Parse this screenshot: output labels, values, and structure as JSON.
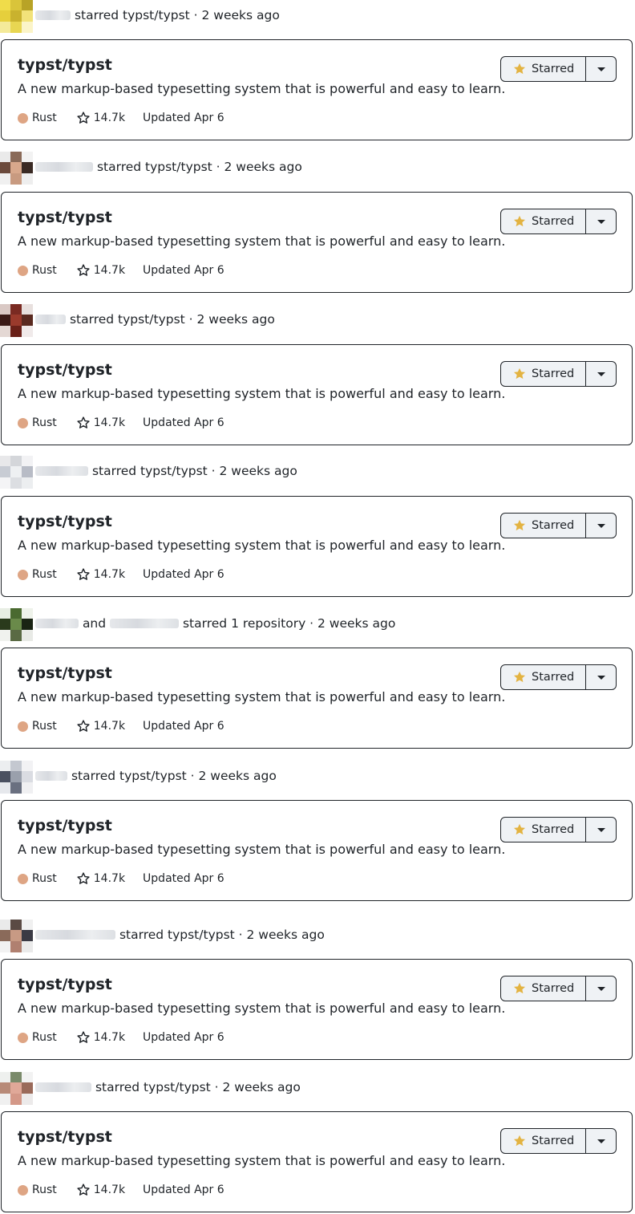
{
  "feed": [
    {
      "text": "starred typst/typst · 2 weeks ago",
      "name_width": 44,
      "avatar": "yellow",
      "repo": {
        "name": "typst/typst",
        "description": "A new markup-based typesetting system that is powerful and easy to learn.",
        "language": "Rust",
        "stars": "14.7k",
        "updated": "Updated Apr 6",
        "button": "Starred"
      }
    },
    {
      "text": "starred typst/typst · 2 weeks ago",
      "name_width": 72,
      "avatar": "face-tan",
      "repo": {
        "name": "typst/typst",
        "description": "A new markup-based typesetting system that is powerful and easy to learn.",
        "language": "Rust",
        "stars": "14.7k",
        "updated": "Updated Apr 6",
        "button": "Starred"
      }
    },
    {
      "text": "starred typst/typst · 2 weeks ago",
      "name_width": 38,
      "avatar": "dark-red",
      "repo": {
        "name": "typst/typst",
        "description": "A new markup-based typesetting system that is powerful and easy to learn.",
        "language": "Rust",
        "stars": "14.7k",
        "updated": "Updated Apr 6",
        "button": "Starred"
      }
    },
    {
      "text": "starred typst/typst · 2 weeks ago",
      "name_width": 66,
      "avatar": "light-grey",
      "repo": {
        "name": "typst/typst",
        "description": "A new markup-based typesetting system that is powerful and easy to learn.",
        "language": "Rust",
        "stars": "14.7k",
        "updated": "Updated Apr 6",
        "button": "Starred"
      }
    },
    {
      "text_pre": "and",
      "text": "starred 1 repository · 2 weeks ago",
      "name_width": 54,
      "name2_width": 86,
      "avatar": "green",
      "repo": {
        "name": "typst/typst",
        "description": "A new markup-based typesetting system that is powerful and easy to learn.",
        "language": "Rust",
        "stars": "14.7k",
        "updated": "Updated Apr 6",
        "button": "Starred"
      }
    },
    {
      "text": "starred typst/typst · 2 weeks ago",
      "name_width": 40,
      "avatar": "grey-blue",
      "repo": {
        "name": "typst/typst",
        "description": "A new markup-based typesetting system that is powerful and easy to learn.",
        "language": "Rust",
        "stars": "14.7k",
        "updated": "Updated Apr 6",
        "button": "Starred"
      }
    },
    {
      "text": "starred typst/typst · 2 weeks ago",
      "name_width": 100,
      "avatar": "face-dark",
      "repo": {
        "name": "typst/typst",
        "description": "A new markup-based typesetting system that is powerful and easy to learn.",
        "language": "Rust",
        "stars": "14.7k",
        "updated": "Updated Apr 6",
        "button": "Starred"
      }
    },
    {
      "text": "starred typst/typst · 2 weeks ago",
      "name_width": 70,
      "avatar": "face-pink",
      "repo": {
        "name": "typst/typst",
        "description": "A new markup-based typesetting system that is powerful and easy to learn.",
        "language": "Rust",
        "stars": "14.7k",
        "updated": "Updated Apr 6",
        "button": "Starred"
      }
    }
  ],
  "colors": {
    "rust": "#dea584",
    "star_fill": "#e3b341"
  }
}
